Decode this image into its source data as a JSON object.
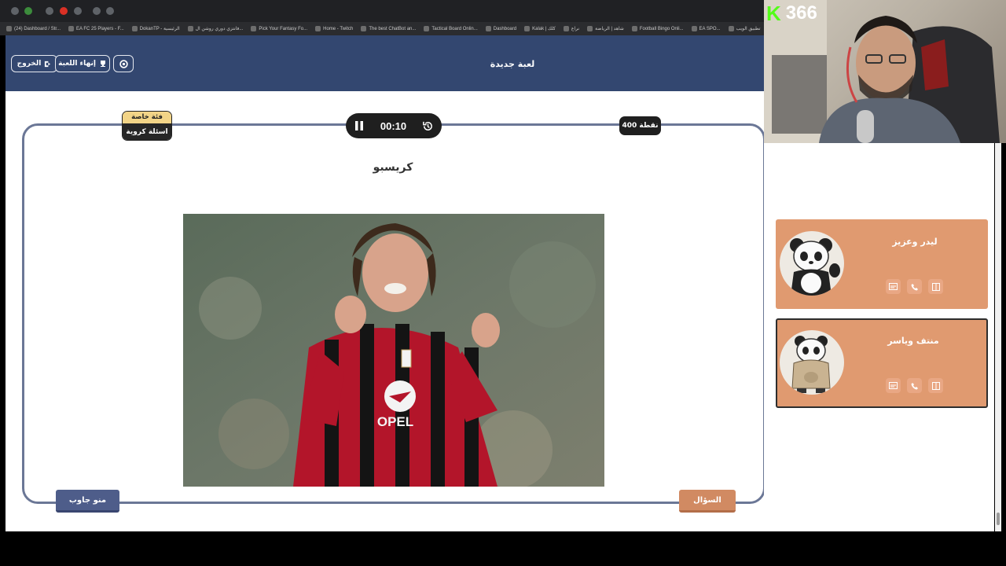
{
  "browser": {
    "bookmarks": [
      {
        "label": "(24) Dashboard / Str..."
      },
      {
        "label": "EA FC 25 Players - F..."
      },
      {
        "label": "DokanTP - الرئيسية"
      },
      {
        "label": "فانتزي دوري روشن ال..."
      },
      {
        "label": "Pick Your Fantasy Fo..."
      },
      {
        "label": "Home - Twitch"
      },
      {
        "label": "The best ChatBot an..."
      },
      {
        "label": "Tactical Board Onlin..."
      },
      {
        "label": "Dashboard"
      },
      {
        "label": "Kalak | كلك"
      },
      {
        "label": "نراع"
      },
      {
        "label": "شاهد | الرياضة"
      },
      {
        "label": "Football Bingo Onli..."
      },
      {
        "label": "EA SPO..."
      },
      {
        "label": "تطبيق الويب"
      }
    ]
  },
  "header": {
    "title": "لعبة جديدة",
    "exit_label": "الخروج",
    "end_game_label": "إنهاء اللعبة"
  },
  "game": {
    "category_top": "فئة خاصة",
    "category_bottom": "اسئلة كروية",
    "timer": "00:10",
    "points": "400 نقطة",
    "answer": "كريسبو",
    "who_answered_label": "منو جاوب",
    "question_label": "السؤال",
    "image_jersey_text": "OPEL"
  },
  "teams": [
    {
      "name": "ليدر وعزيز"
    },
    {
      "name": "منتف وياسر"
    }
  ],
  "stream": {
    "viewers": "366",
    "platform_logo": "K"
  },
  "colors": {
    "header_bg": "#334770",
    "card_bg": "#e09a70",
    "question_btn": "#d18a62",
    "who_btn": "#4e5d8a",
    "frame_border": "#6b7796"
  }
}
